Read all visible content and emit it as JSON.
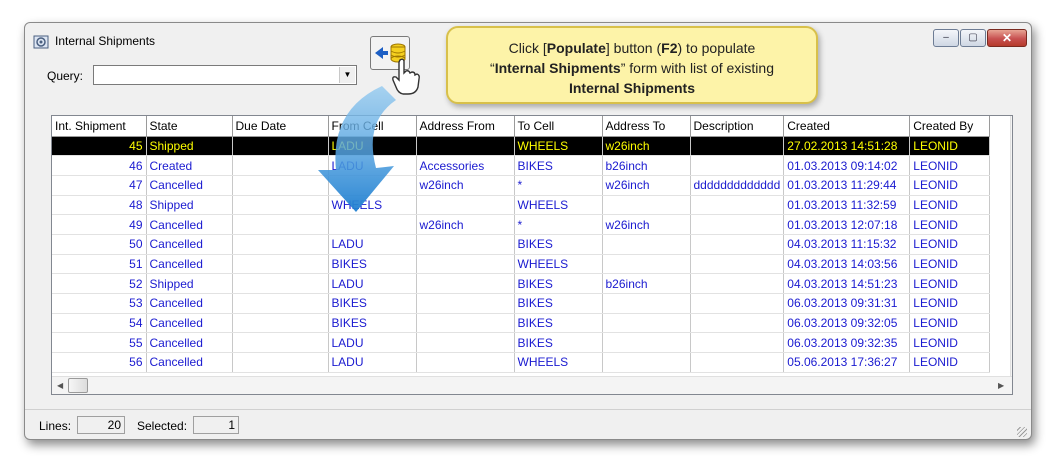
{
  "window": {
    "title": "Internal Shipments",
    "caption": {
      "minimize": "–",
      "maximize": "▢",
      "close": "✕"
    }
  },
  "query": {
    "label": "Query:",
    "value": ""
  },
  "grid": {
    "columns": [
      "Int. Shipment",
      "State",
      "Due Date",
      "From Cell",
      "Address From",
      "To Cell",
      "Address To",
      "Description",
      "Created",
      "Created By"
    ],
    "rows": [
      [
        "45",
        "Shipped",
        "",
        "LADU",
        "",
        "WHEELS",
        "w26inch",
        "",
        "27.02.2013 14:51:28",
        "LEONID"
      ],
      [
        "46",
        "Created",
        "",
        "LADU",
        "Accessories",
        "BIKES",
        "b26inch",
        "",
        "01.03.2013 09:14:02",
        "LEONID"
      ],
      [
        "47",
        "Cancelled",
        "",
        "",
        "w26inch",
        "*",
        "w26inch",
        "ddddddddddddd",
        "01.03.2013 11:29:44",
        "LEONID"
      ],
      [
        "48",
        "Shipped",
        "",
        "WHEELS",
        "",
        "WHEELS",
        "",
        "",
        "01.03.2013 11:32:59",
        "LEONID"
      ],
      [
        "49",
        "Cancelled",
        "",
        "",
        "w26inch",
        "*",
        "w26inch",
        "",
        "01.03.2013 12:07:18",
        "LEONID"
      ],
      [
        "50",
        "Cancelled",
        "",
        "LADU",
        "",
        "BIKES",
        "",
        "",
        "04.03.2013 11:15:32",
        "LEONID"
      ],
      [
        "51",
        "Cancelled",
        "",
        "BIKES",
        "",
        "WHEELS",
        "",
        "",
        "04.03.2013 14:03:56",
        "LEONID"
      ],
      [
        "52",
        "Shipped",
        "",
        "LADU",
        "",
        "BIKES",
        "b26inch",
        "",
        "04.03.2013 14:51:23",
        "LEONID"
      ],
      [
        "53",
        "Cancelled",
        "",
        "BIKES",
        "",
        "BIKES",
        "",
        "",
        "06.03.2013 09:31:31",
        "LEONID"
      ],
      [
        "54",
        "Cancelled",
        "",
        "BIKES",
        "",
        "BIKES",
        "",
        "",
        "06.03.2013 09:32:05",
        "LEONID"
      ],
      [
        "55",
        "Cancelled",
        "",
        "LADU",
        "",
        "BIKES",
        "",
        "",
        "06.03.2013 09:32:35",
        "LEONID"
      ],
      [
        "56",
        "Cancelled",
        "",
        "LADU",
        "",
        "WHEELS",
        "",
        "",
        "05.06.2013 17:36:27",
        "LEONID"
      ]
    ],
    "selected_row_index": 0,
    "scroll_arrows": {
      "up": "▲",
      "down": "▼",
      "left": "◀",
      "right": "▶"
    }
  },
  "status": {
    "lines_label": "Lines:",
    "lines_value": "20",
    "selected_label": "Selected:",
    "selected_value": "1"
  },
  "callout": {
    "part1": "Click [",
    "populate": "Populate",
    "part2": "] button (",
    "key": "F2",
    "part3": ") to populate",
    "quote_open": "“",
    "form_name": "Internal Shipments",
    "part4": "” form with list of existing",
    "part5": "Internal Shipments"
  },
  "colors": {
    "row_text": "#1a1ad0",
    "selected_bg": "#000000",
    "selected_text": "#ffff00",
    "callout_bg": "#fdf3a8",
    "arrow": "#2a8fd8"
  },
  "icons": [
    "app-window-icon",
    "populate-database-icon",
    "pointing-hand-icon",
    "callout-arrow-icon"
  ]
}
